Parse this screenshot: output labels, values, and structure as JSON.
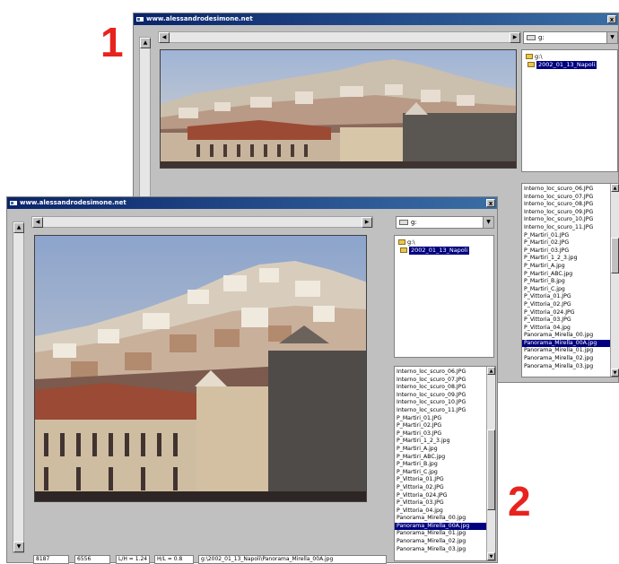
{
  "window1": {
    "title": "www.alessandrodesimone.net",
    "close_label": "x",
    "drive_combo": "g:",
    "tree": {
      "root": "g:\\",
      "folder": "2002_01_13_Napoli"
    },
    "files": [
      "Interno_loc_scuro_06.JPG",
      "Interno_loc_scuro_07.JPG",
      "Interno_loc_scuro_08.JPG",
      "Interno_loc_scuro_09.JPG",
      "Interno_loc_scuro_10.JPG",
      "Interno_loc_scuro_11.JPG",
      "P_Martiri_01.JPG",
      "P_Martiri_02.JPG",
      "P_Martiri_03.JPG",
      "P_Martiri_1_2_3.jpg",
      "P_Martiri_A.jpg",
      "P_Martiri_ABC.jpg",
      "P_Martiri_B.jpg",
      "P_Martiri_C.jpg",
      "P_Vittoria_01.JPG",
      "P_Vittoria_02.JPG",
      "P_Vittoria_024.JPG",
      "P_Vittoria_03.JPG",
      "P_Vittoria_04.jpg",
      "Panorama_Mirella_00.jpg",
      "Panorama_Mirella_00A.jpg",
      "Panorama_Mirella_01.jpg",
      "Panorama_Mirella_02.jpg",
      "Panorama_Mirella_03.jpg"
    ],
    "selected_index": 20
  },
  "window2": {
    "title": "www.alessandrodesimone.net",
    "close_label": "x",
    "drive_combo": "g:",
    "tree": {
      "root": "g:\\",
      "folder": "2002_01_13_Napoli"
    },
    "files": [
      "Interno_loc_scuro_06.JPG",
      "Interno_loc_scuro_07.JPG",
      "Interno_loc_scuro_08.JPG",
      "Interno_loc_scuro_09.JPG",
      "Interno_loc_scuro_10.JPG",
      "Interno_loc_scuro_11.JPG",
      "P_Martiri_01.JPG",
      "P_Martiri_02.JPG",
      "P_Martiri_03.JPG",
      "P_Martiri_1_2_3.jpg",
      "P_Martiri_A.jpg",
      "P_Martiri_ABC.jpg",
      "P_Martiri_B.jpg",
      "P_Martiri_C.jpg",
      "P_Vittoria_01.JPG",
      "P_Vittoria_02.JPG",
      "P_Vittoria_024.JPG",
      "P_Vittoria_03.JPG",
      "P_Vittoria_04.jpg",
      "Panorama_Mirella_00.jpg",
      "Panorama_Mirella_00A.jpg",
      "Panorama_Mirella_01.jpg",
      "Panorama_Mirella_02.jpg",
      "Panorama_Mirella_03.jpg"
    ],
    "selected_index": 20,
    "status": {
      "width": "8187",
      "height": "6556",
      "ratio_lh": "L/H = 1.24",
      "ratio_hl": "H/L = 0.8",
      "path": "g:\\2002_01_13_Napoli\\Panorama_Mirella_00A.jpg"
    }
  },
  "labels": {
    "one": "1",
    "two": "2"
  },
  "colors": {
    "titlebar": "#0a246a",
    "selection": "#000080",
    "label_red": "#e8231e",
    "window_bg": "#c0c0c0"
  }
}
